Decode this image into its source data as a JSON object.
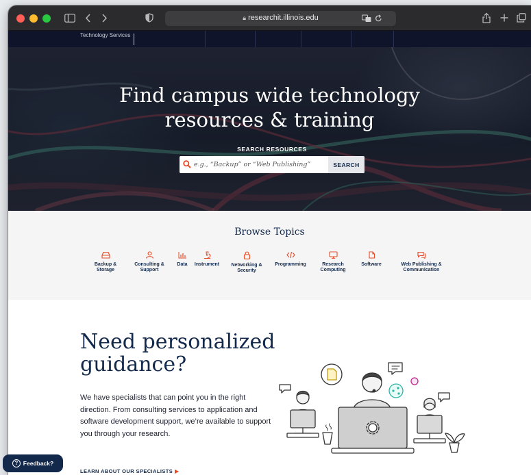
{
  "browser": {
    "url": "researchit.illinois.edu"
  },
  "site": {
    "brand_text": "Technology Services"
  },
  "hero": {
    "heading_line1": "Find campus wide technology",
    "heading_line2": "resources & training",
    "search_label": "SEARCH RESOURCES",
    "search_placeholder": "e.g., “Backup” or “Web Publishing”",
    "search_button": "SEARCH"
  },
  "browse": {
    "title": "Browse Topics",
    "topics": [
      {
        "line1": "Backup &",
        "line2": "Storage",
        "icon": "storage-icon"
      },
      {
        "line1": "Consulting &",
        "line2": "Support",
        "icon": "people-icon"
      },
      {
        "line1": "Data",
        "line2": "",
        "icon": "bar-chart-icon"
      },
      {
        "line1": "Instrument",
        "line2": "",
        "icon": "microscope-icon"
      },
      {
        "line1": "Networking &",
        "line2": "Security",
        "icon": "lock-icon"
      },
      {
        "line1": "Programming",
        "line2": "",
        "icon": "code-icon"
      },
      {
        "line1": "Research",
        "line2": "Computing",
        "icon": "monitor-icon"
      },
      {
        "line1": "Software",
        "line2": "",
        "icon": "software-icon"
      },
      {
        "line1": "Web Publishing &",
        "line2": "Communication",
        "icon": "chat-icon"
      }
    ]
  },
  "guidance": {
    "heading_line1": "Need personalized",
    "heading_line2": "guidance?",
    "body": "We have specialists that can point you in the right direction. From consulting services to application and software development support, we’re available to support you through your research.",
    "link": "LEARN ABOUT OUR SPECIALISTS"
  },
  "feedback": {
    "label": "Feedback?"
  },
  "colors": {
    "navy": "#13294b",
    "orange": "#e84a27",
    "browse_bg": "#f5f5f5"
  }
}
